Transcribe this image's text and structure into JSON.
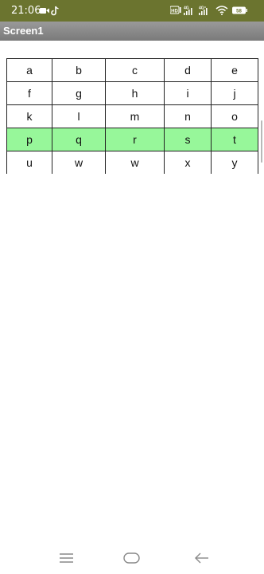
{
  "status_bar": {
    "time": "21:06",
    "left_icons": [
      "video-camera-icon",
      "tiktok-icon"
    ],
    "right_icons": [
      "hd-icon",
      "4g-signal-icon",
      "4g-signal-icon",
      "wifi-icon",
      "battery-icon"
    ],
    "battery": "58"
  },
  "title_bar": {
    "title": "Screen1"
  },
  "grid": {
    "rows": [
      {
        "cells": [
          "a",
          "b",
          "c",
          "d",
          "e"
        ]
      },
      {
        "cells": [
          "f",
          "g",
          "h",
          "i",
          "j"
        ]
      },
      {
        "cells": [
          "k",
          "l",
          "m",
          "n",
          "o"
        ]
      },
      {
        "cells": [
          "p",
          "q",
          "r",
          "s",
          "t"
        ]
      },
      {
        "cells": [
          "u",
          "w",
          "w",
          "x",
          "y"
        ]
      }
    ],
    "highlight_color": "#97f79a"
  },
  "nav_bar": {
    "buttons": [
      "menu-icon",
      "home-icon",
      "back-icon"
    ]
  },
  "colors": {
    "status_bar": "#6b742f",
    "title_bar": "#8a8a8a"
  }
}
